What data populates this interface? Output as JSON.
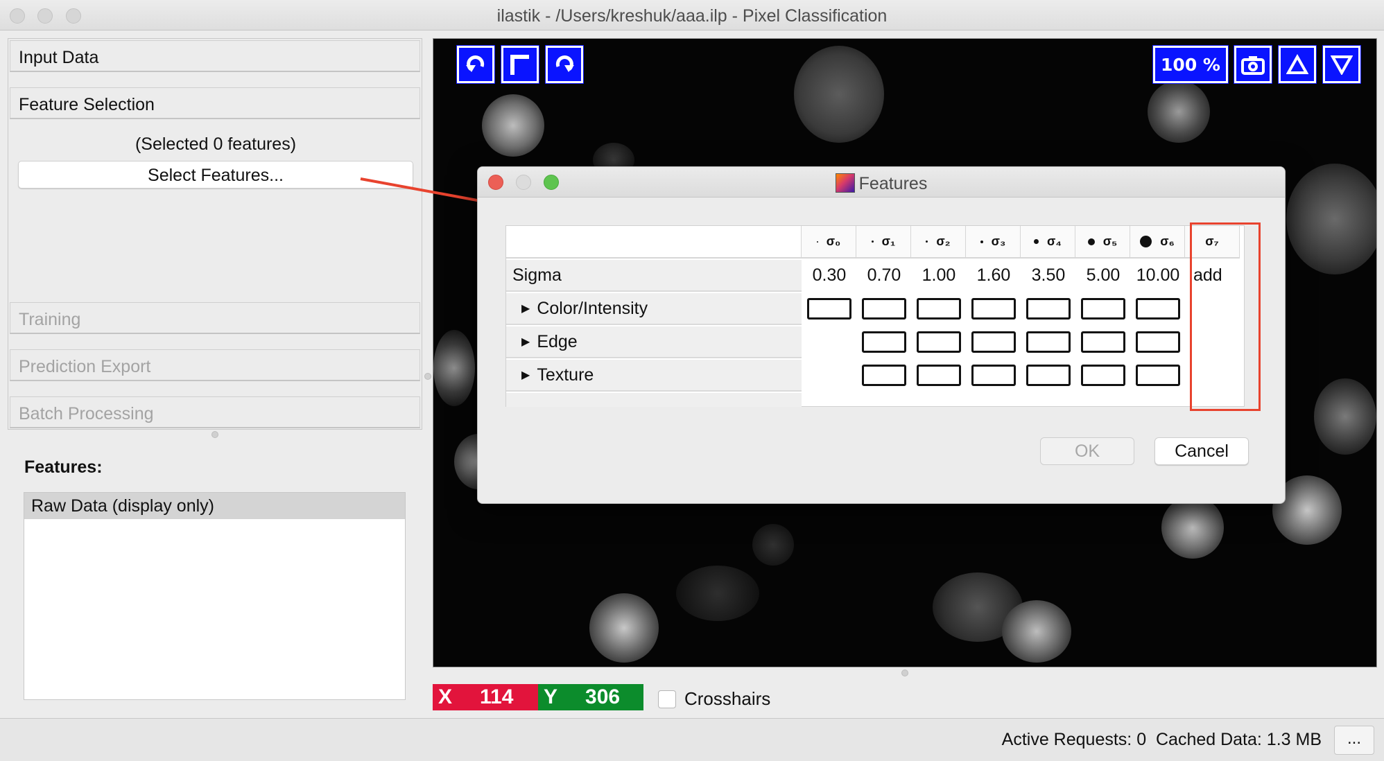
{
  "window": {
    "title": "ilastik - /Users/kreshuk/aaa.ilp - Pixel Classification"
  },
  "applets": {
    "input_data": "Input Data",
    "feature_selection": "Feature Selection",
    "selected_count": "(Selected 0 features)",
    "select_features_button": "Select Features...",
    "training": "Training",
    "prediction_export": "Prediction Export",
    "batch_processing": "Batch Processing"
  },
  "layers": {
    "heading": "Features:",
    "items": [
      "Raw Data (display only)"
    ]
  },
  "viewer": {
    "zoom_label": "100 %",
    "icons": [
      "rotate-left-icon",
      "swap-axes-icon",
      "rotate-right-icon",
      "camera-icon",
      "up-triangle-icon",
      "down-triangle-icon"
    ],
    "x_label": "X",
    "x_value": "114",
    "y_label": "Y",
    "y_value": "306",
    "crosshairs_label": "Crosshairs",
    "colors": {
      "button_blue": "#0a14ff",
      "x_red": "#e2143c",
      "y_green": "#0c8c2c"
    }
  },
  "status": {
    "text": "Active Requests: 0  Cached Data: 1.3 MB",
    "more_button": "..."
  },
  "dialog": {
    "title": "Features",
    "sigma_headers": [
      "σ₀",
      "σ₁",
      "σ₂",
      "σ₃",
      "σ₄",
      "σ₅",
      "σ₆",
      "σ₇"
    ],
    "sigma_row_label": "Sigma",
    "sigma_values": [
      "0.30",
      "0.70",
      "1.00",
      "1.60",
      "3.50",
      "5.00",
      "10.00",
      "add"
    ],
    "feature_groups": [
      "Color/Intensity",
      "Edge",
      "Texture"
    ],
    "checkboxes": {
      "Color/Intensity": [
        false,
        false,
        false,
        false,
        false,
        false,
        false
      ],
      "Edge": [
        null,
        false,
        false,
        false,
        false,
        false,
        false
      ],
      "Texture": [
        null,
        false,
        false,
        false,
        false,
        false,
        false
      ]
    },
    "ok_label": "OK",
    "cancel_label": "Cancel",
    "highlight_color": "#e8432e"
  }
}
